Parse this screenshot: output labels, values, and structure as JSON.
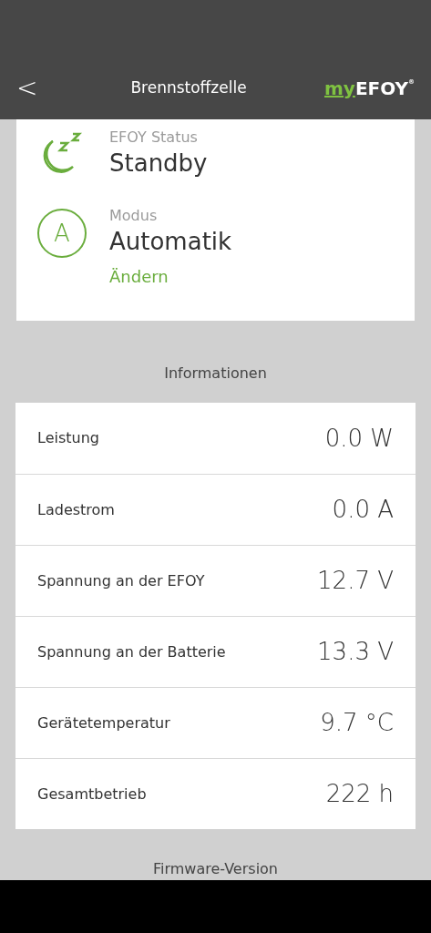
{
  "header": {
    "back": "<",
    "title": "Brennstoffzelle",
    "logo": {
      "prefix": "my",
      "name": "EFOY",
      "mark": "®"
    }
  },
  "status_card": {
    "items": [
      {
        "kind": "status",
        "label": "EFOY Status",
        "value": "Standby"
      },
      {
        "kind": "mode",
        "label": "Modus",
        "value": "Automatik",
        "icon_letter": "A",
        "action": "Ändern"
      }
    ]
  },
  "informationen": {
    "heading": "Informationen",
    "rows": [
      {
        "label": "Leistung",
        "value": "0.0 W"
      },
      {
        "label": "Ladestrom",
        "value": "0.0 A"
      },
      {
        "label": "Spannung an der EFOY",
        "value": "12.7 V"
      },
      {
        "label": "Spannung an der Batterie",
        "value": "13.3 V"
      },
      {
        "label": "Gerätetemperatur",
        "value": "9.7 °C"
      },
      {
        "label": "Gesamtbetrieb",
        "value": "222 h"
      }
    ]
  },
  "firmware": {
    "heading": "Firmware-Version"
  }
}
